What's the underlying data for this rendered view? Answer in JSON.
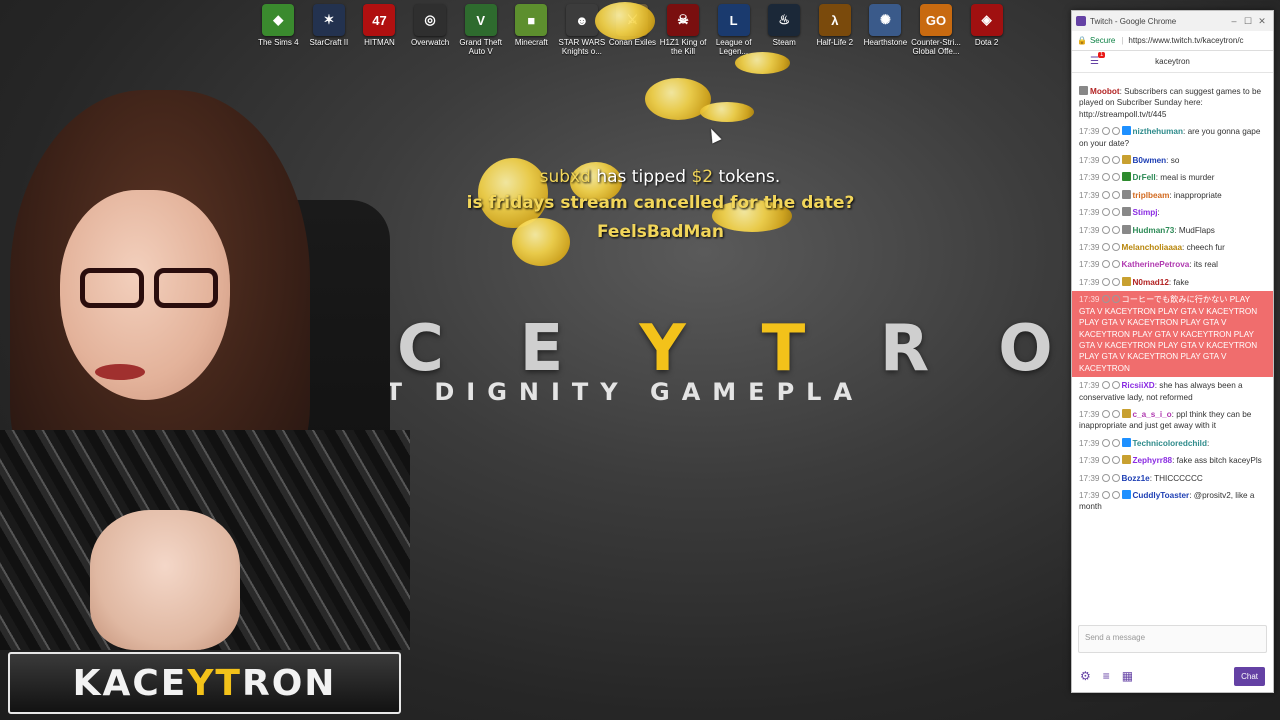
{
  "desktop_icons": [
    {
      "label": "The Sims 4",
      "icon": "sims-icon",
      "color": "#3a8a2e",
      "glyph": "◆"
    },
    {
      "label": "StarCraft II",
      "icon": "starcraft-icon",
      "color": "#23324f",
      "glyph": "✶"
    },
    {
      "label": "HITMAN",
      "icon": "hitman-icon",
      "color": "#b01010",
      "glyph": "47"
    },
    {
      "label": "Overwatch",
      "icon": "overwatch-icon",
      "color": "#2f2f2f",
      "glyph": "◎"
    },
    {
      "label": "Grand Theft Auto V",
      "icon": "gta-icon",
      "color": "#2e6b2e",
      "glyph": "V"
    },
    {
      "label": "Minecraft",
      "icon": "minecraft-icon",
      "color": "#5d8f2e",
      "glyph": "■"
    },
    {
      "label": "STAR WARS Knights o...",
      "icon": "starwars-icon",
      "color": "#3c3c3c",
      "glyph": "☻"
    },
    {
      "label": "Conan Exiles",
      "icon": "conan-icon",
      "color": "#6b5b3a",
      "glyph": "⚔"
    },
    {
      "label": "H1Z1 King of the Kill",
      "icon": "h1z1-icon",
      "color": "#7a0f0f",
      "glyph": "☠"
    },
    {
      "label": "League of Legen...",
      "icon": "lol-icon",
      "color": "#1a3a6e",
      "glyph": "L"
    },
    {
      "label": "Steam",
      "icon": "steam-icon",
      "color": "#1b2838",
      "glyph": "♨"
    },
    {
      "label": "Half-Life 2",
      "icon": "halflife-icon",
      "color": "#7a4a0c",
      "glyph": "λ"
    },
    {
      "label": "Hearthstone",
      "icon": "hearthstone-icon",
      "color": "#3a5a8a",
      "glyph": "✺"
    },
    {
      "label": "Counter-Stri... Global Offe...",
      "icon": "csgo-icon",
      "color": "#c86a10",
      "glyph": "GO"
    },
    {
      "label": "Dota 2",
      "icon": "dota-icon",
      "color": "#a01010",
      "glyph": "◈"
    }
  ],
  "tip": {
    "user": "subxd",
    "verb": "has tipped",
    "amount": "$2",
    "unit": "tokens.",
    "message": "is fridays stream cancelled for the date?",
    "emote": "FeelsBadMan"
  },
  "brand": {
    "letters": [
      "C",
      "E",
      "Y",
      "T",
      "R",
      "O"
    ],
    "tagline": "CT  DIGNITY  GAMEPLA",
    "logo_a": "KACE",
    "logo_b": "YT",
    "logo_c": "RON"
  },
  "browser": {
    "title": "Twitch - Google Chrome",
    "secure": "Secure",
    "url": "https://www.twitch.tv/kaceytron/c",
    "channel": "kaceytron",
    "notif_count": "1"
  },
  "chat": [
    {
      "time": "",
      "name": "Moobot",
      "color": "#b22222",
      "text": "Subscribers can suggest games to be played on Subcriber Sunday here: http://streampoll.tv/t/445",
      "badge": "#888888"
    },
    {
      "time": "17:39",
      "name": "nizthehuman",
      "color": "#2e8b8b",
      "text": "are you gonna gape on your date?",
      "badge": "#1e90ff"
    },
    {
      "time": "17:39",
      "name": "B0wmen",
      "color": "#1e3fb4",
      "text": "so",
      "badge": "#c8a030"
    },
    {
      "time": "17:39",
      "name": "DrFell",
      "color": "#2e8b57",
      "text": "meal is murder",
      "badge": "#2e8b2e"
    },
    {
      "time": "17:39",
      "name": "triplbeam",
      "color": "#d2691e",
      "text": "inappropriate",
      "badge": "#888888"
    },
    {
      "time": "17:39",
      "name": "Stimpj",
      "color": "#8a2be2",
      "text": "",
      "badge": "#888888"
    },
    {
      "time": "17:39",
      "name": "Hudman73",
      "color": "#2e8b57",
      "text": "MudFlaps",
      "badge": "#888888"
    },
    {
      "time": "17:39",
      "name": "Melancholiaaaa",
      "color": "#b8860b",
      "text": "cheech fur",
      "badge": ""
    },
    {
      "time": "17:39",
      "name": "KatherinePetrova",
      "color": "#b03ab0",
      "text": "its real",
      "badge": ""
    },
    {
      "time": "17:39",
      "name": "N0mad12",
      "color": "#b22222",
      "text": "fake",
      "badge": "#c8a030"
    },
    {
      "time": "17:39",
      "name": "",
      "color": "#ffffff",
      "text": "コーヒーでも飲みに行かない PLAY GTA V KACEYTRON PLAY GTA V KACEYTRON PLAY GTA V KACEYTRON PLAY GTA V KACEYTRON PLAY GTA V KACEYTRON PLAY GTA V KACEYTRON PLAY GTA V KACEYTRON PLAY GTA V KACEYTRON PLAY GTA V KACEYTRON",
      "badge": "",
      "highlight": true
    },
    {
      "time": "17:39",
      "name": "RicsiiXD",
      "color": "#8a2be2",
      "text": "she has always been a conservative lady, not reformed",
      "badge": ""
    },
    {
      "time": "17:39",
      "name": "c_a_s_i_o",
      "color": "#b03ab0",
      "text": "ppl think they can be inappropriate and just get away with it",
      "badge": "#c8a030"
    },
    {
      "time": "17:39",
      "name": "Technicoloredchild",
      "color": "#2e8b8b",
      "text": "",
      "badge": "#1e90ff"
    },
    {
      "time": "17:39",
      "name": "Zephyrr88",
      "color": "#8a2be2",
      "text": "fake ass bitch kaceyPls",
      "badge": "#c8a030"
    },
    {
      "time": "17:39",
      "name": "Bozz1e",
      "color": "#1e3fb4",
      "text": "THICCCCCC",
      "badge": ""
    },
    {
      "time": "17:39",
      "name": "CuddlyToaster",
      "color": "#1e3fb4",
      "text": "@prositv2, like a month",
      "badge": "#1e90ff"
    }
  ],
  "chat_input": {
    "placeholder": "Send a message",
    "button": "Chat"
  },
  "colors": {
    "twitch_purple": "#6441a4",
    "gold": "#f3c21a",
    "highlight": "#f06d6d"
  }
}
